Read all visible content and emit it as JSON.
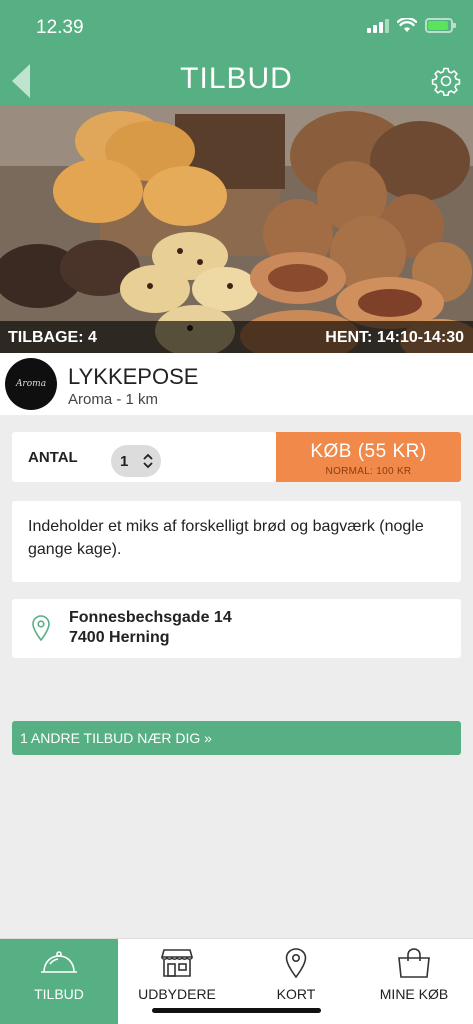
{
  "status": {
    "time": "12.39"
  },
  "header": {
    "title": "TILBUD",
    "back_icon": "back-arrow-icon",
    "settings_icon": "gear-icon"
  },
  "hero": {
    "left_text": "TILBAGE: 4",
    "right_text": "HENT: 14:10-14:30"
  },
  "vendor": {
    "logo_text": "Aroma",
    "title": "LYKKEPOSE",
    "subtitle": "Aroma - 1 km"
  },
  "purchase": {
    "qty_label": "ANTAL",
    "qty_value": "1",
    "buy_label": "KØB (55 KR)",
    "normal_price": "NORMAL: 100 KR",
    "buy_color": "#f0894a"
  },
  "description": "Indeholder et miks af forskelligt brød og bagværk (nogle gange kage).",
  "address": {
    "line1": "Fonnesbechsgade 14",
    "line2": "7400 Herning"
  },
  "other_offers": "1 ANDRE TILBUD NÆR DIG »",
  "tabs": [
    {
      "label": "TILBUD",
      "icon": "cloche-icon",
      "active": true
    },
    {
      "label": "UDBYDERE",
      "icon": "store-icon",
      "active": false
    },
    {
      "label": "KORT",
      "icon": "map-pin-icon",
      "active": false
    },
    {
      "label": "MINE KØB",
      "icon": "shopping-bag-icon",
      "active": false
    }
  ],
  "colors": {
    "brand": "#56b083",
    "accent": "#f0894a",
    "background": "#ededed"
  }
}
